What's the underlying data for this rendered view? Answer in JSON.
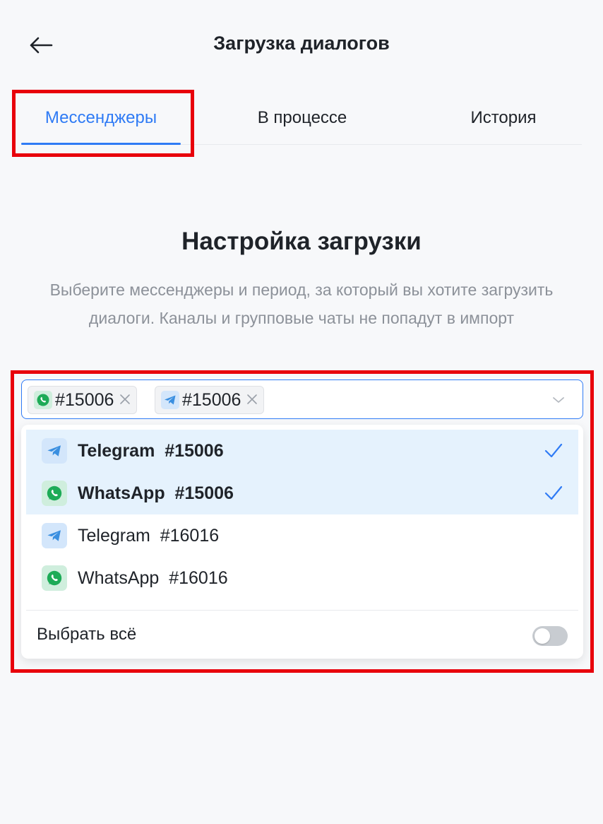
{
  "header": {
    "title": "Загрузка диалогов"
  },
  "tabs": [
    {
      "label": "Мессенджеры",
      "active": true
    },
    {
      "label": "В процессе",
      "active": false
    },
    {
      "label": "История",
      "active": false
    }
  ],
  "section": {
    "title": "Настройка загрузки",
    "description": "Выберите мессенджеры и период, за который вы хотите загрузить диалоги. Каналы и групповые чаты не попадут в импорт"
  },
  "select": {
    "chips": [
      {
        "icon": "whatsapp-icon",
        "label": "#15006"
      },
      {
        "icon": "telegram-icon",
        "label": "#15006"
      }
    ]
  },
  "dropdown": {
    "options": [
      {
        "icon": "telegram-icon",
        "label": "Telegram  #15006",
        "selected": true
      },
      {
        "icon": "whatsapp-icon",
        "label": "WhatsApp  #15006",
        "selected": true
      },
      {
        "icon": "telegram-icon",
        "label": "Telegram  #16016",
        "selected": false
      },
      {
        "icon": "whatsapp-icon",
        "label": "WhatsApp  #16016",
        "selected": false
      }
    ],
    "select_all_label": "Выбрать всё",
    "select_all_on": false
  },
  "colors": {
    "accent": "#2f7bf5",
    "highlight_border": "#e8000b",
    "selected_row": "#e5f2fd",
    "telegram": "#3a8fe0",
    "whatsapp": "#1dab57"
  }
}
